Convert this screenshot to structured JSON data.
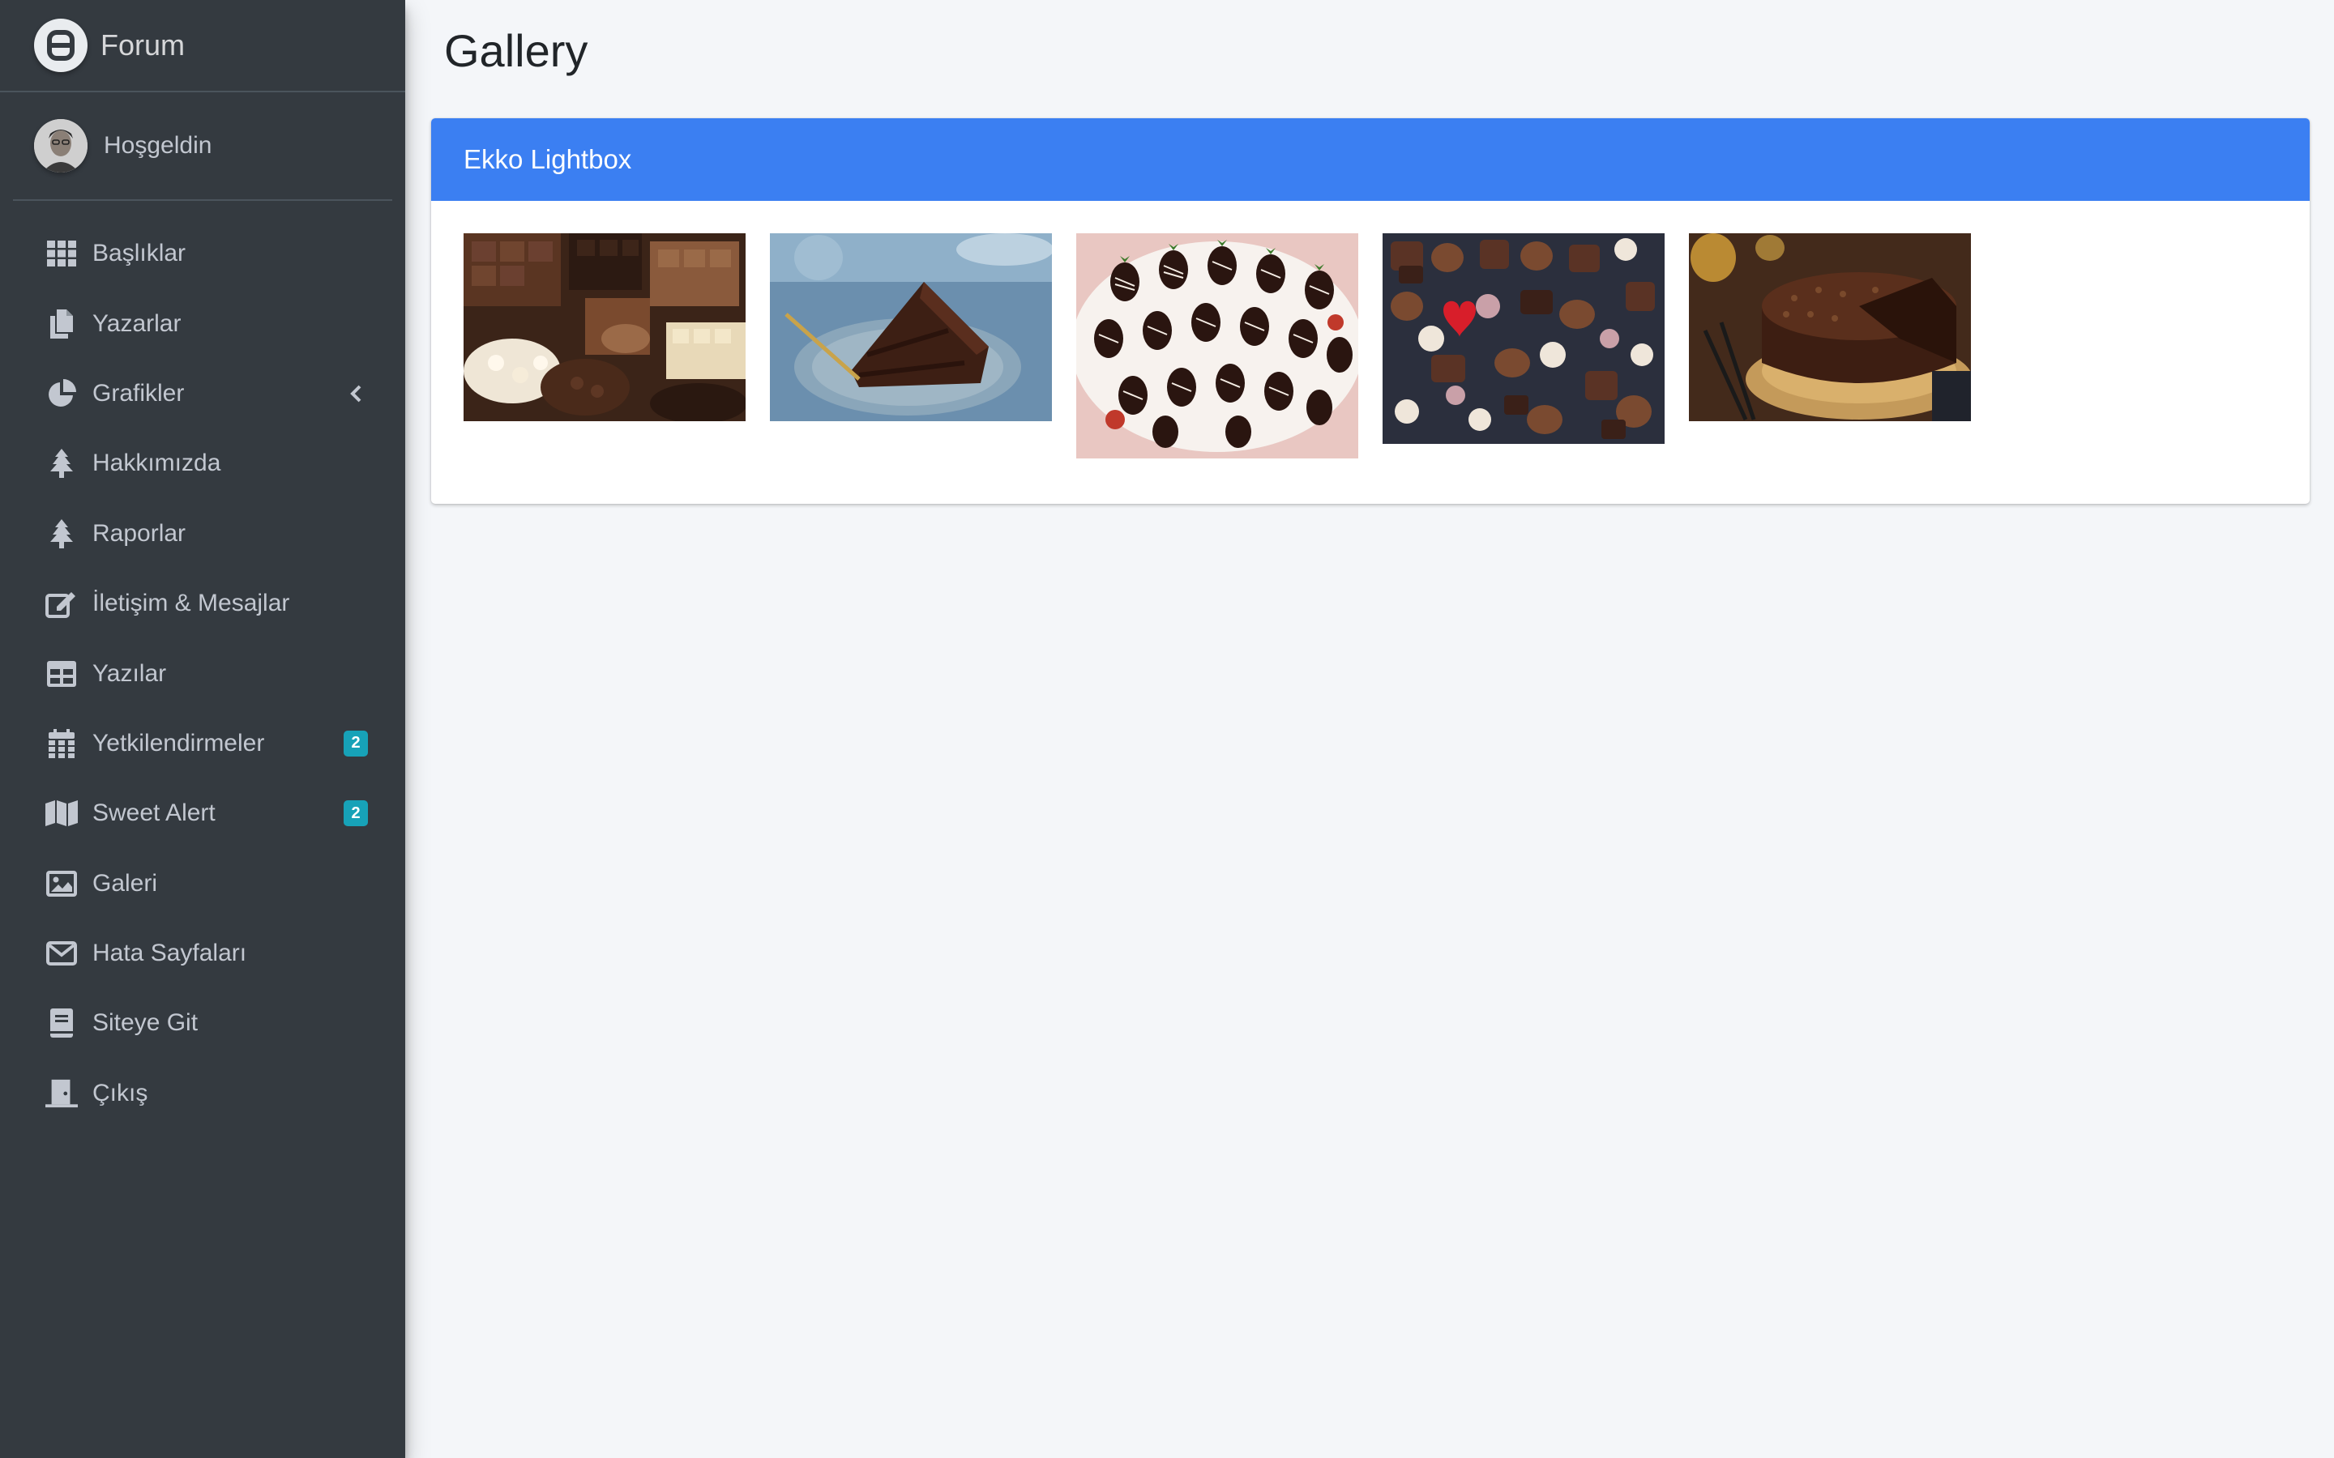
{
  "brand": {
    "name": "Forum",
    "logo_icon": "forum-logo-icon"
  },
  "user": {
    "greeting": "Hoşgeldin"
  },
  "sidebar": {
    "items": [
      {
        "label": "Başlıklar",
        "icon": "grid-icon"
      },
      {
        "label": "Yazarlar",
        "icon": "copy-icon"
      },
      {
        "label": "Grafikler",
        "icon": "pie-chart-icon",
        "chevron": true
      },
      {
        "label": "Hakkımızda",
        "icon": "tree-icon"
      },
      {
        "label": "Raporlar",
        "icon": "tree-icon"
      },
      {
        "label": "İletişim & Mesajlar",
        "icon": "edit-icon"
      },
      {
        "label": "Yazılar",
        "icon": "table-icon"
      },
      {
        "label": "Yetkilendirmeler",
        "icon": "calendar-icon",
        "badge": "2"
      },
      {
        "label": "Sweet Alert",
        "icon": "map-icon",
        "badge": "2"
      },
      {
        "label": "Galeri",
        "icon": "image-icon"
      },
      {
        "label": "Hata Sayfaları",
        "icon": "envelope-icon"
      },
      {
        "label": "Siteye Git",
        "icon": "book-icon"
      },
      {
        "label": "Çıkış",
        "icon": "door-icon"
      }
    ]
  },
  "main": {
    "title": "Gallery",
    "card": {
      "header": "Ekko Lightbox",
      "images": [
        {
          "name": "chocolate-bars-image"
        },
        {
          "name": "chocolate-cake-slice-image"
        },
        {
          "name": "chocolate-strawberries-image"
        },
        {
          "name": "assorted-chocolates-image"
        },
        {
          "name": "chocolate-cake-image"
        }
      ]
    }
  },
  "colors": {
    "sidebar_bg": "#343a40",
    "card_header_bg": "#3b7ff2",
    "badge_bg": "#17a2b8",
    "content_bg": "#f4f6f9"
  }
}
